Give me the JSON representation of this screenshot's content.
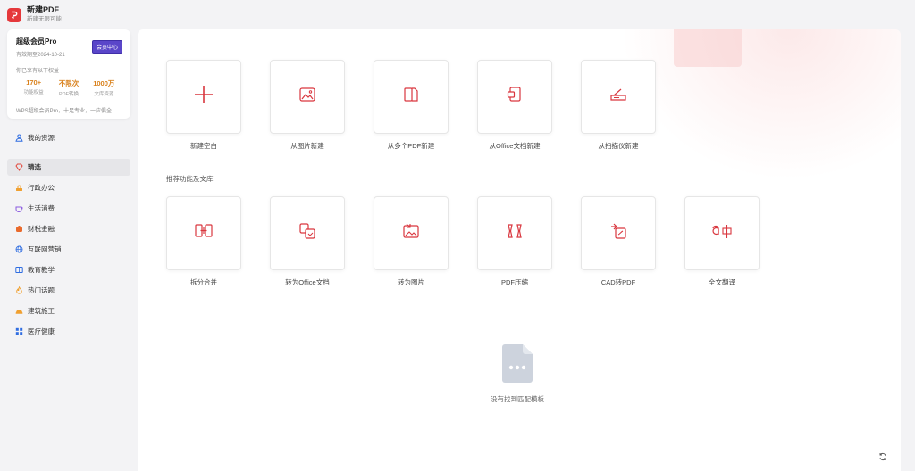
{
  "app": {
    "title": "新建PDF",
    "subtitle": "新建无限可能"
  },
  "member": {
    "name": "超级会员Pro",
    "expiry": "有效期至2024-10-21",
    "center_button": "会员中心",
    "intro": "你已享有以下权益",
    "stats": [
      {
        "value": "170+",
        "label": "功能权益"
      },
      {
        "value": "不限次",
        "label": "PDF转换"
      },
      {
        "value": "1000万",
        "label": "文库资源"
      }
    ],
    "footer": "WPS超级会员Pro，十足专业，一应俱全"
  },
  "sidebar": {
    "resources": {
      "label": "我的资源",
      "icon": "user-icon"
    },
    "items": [
      {
        "label": "精选",
        "icon": "gem-icon",
        "active": true
      },
      {
        "label": "行政办公",
        "icon": "stamp-icon"
      },
      {
        "label": "生活消费",
        "icon": "cup-icon"
      },
      {
        "label": "财税金融",
        "icon": "money-icon"
      },
      {
        "label": "互联网营销",
        "icon": "globe-icon"
      },
      {
        "label": "教育教学",
        "icon": "book-icon"
      },
      {
        "label": "热门话题",
        "icon": "fire-icon"
      },
      {
        "label": "建筑施工",
        "icon": "helmet-icon"
      },
      {
        "label": "医疗健康",
        "icon": "grid-icon"
      }
    ]
  },
  "create_tiles": [
    {
      "label": "新建空白",
      "icon": "plus-icon"
    },
    {
      "label": "从图片新建",
      "icon": "image-icon"
    },
    {
      "label": "从多个PDF新建",
      "icon": "multi-pdf-icon"
    },
    {
      "label": "从Office文档新建",
      "icon": "office-doc-icon"
    },
    {
      "label": "从扫描仪新建",
      "icon": "scanner-icon"
    }
  ],
  "section_title": "推荐功能及文库",
  "feature_tiles": [
    {
      "label": "拆分合并",
      "icon": "split-merge-icon"
    },
    {
      "label": "转为Office文档",
      "icon": "convert-office-icon"
    },
    {
      "label": "转为图片",
      "icon": "convert-image-icon"
    },
    {
      "label": "PDF压缩",
      "icon": "compress-icon"
    },
    {
      "label": "CAD转PDF",
      "icon": "cad-icon"
    },
    {
      "label": "全文翻译",
      "icon": "translate-icon"
    }
  ],
  "empty_state": {
    "text": "没有找到匹配模板",
    "icon": "empty-file-icon"
  },
  "colors": {
    "accent": "#d9363e",
    "vip": "#5a46c9",
    "stat": "#d9821e"
  }
}
